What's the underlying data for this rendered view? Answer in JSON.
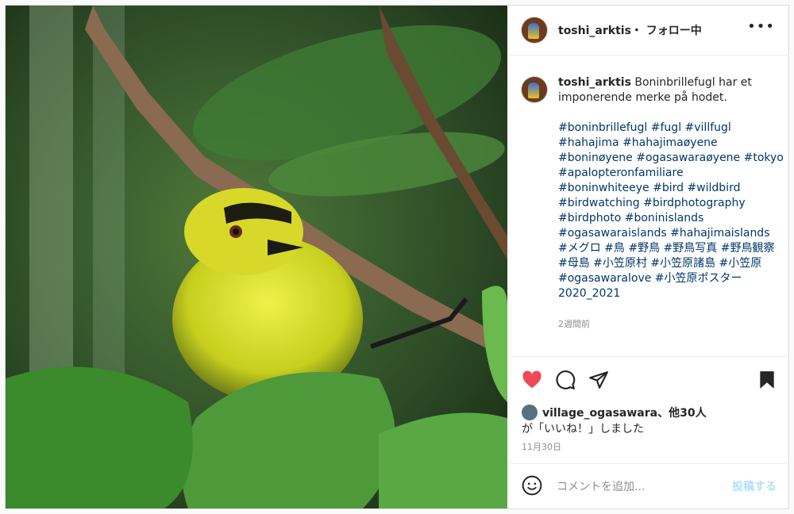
{
  "post": {
    "username": "toshi_arktis",
    "follow_status": "・ フォロー中",
    "more_label": "•••",
    "caption_text": "Boninbrillefugl har et imponerende merke på hodet.",
    "hashtag_lines": [
      "#boninbrillefugl #fugl #villfugl",
      "#hahajima #hahajimaøyene",
      "#boninøyene #ogasawaraøyene #tokyo",
      "#apalopteronfamiliare",
      "#boninwhiteeye #bird #wildbird",
      "#birdwatching #birdphotography",
      "#birdphoto #boninislands",
      "#ogasawaraislands #hahajimaislands",
      "#メグロ #鳥 #野鳥 #野鳥写真 #野鳥観察",
      "#母島 #小笠原村 #小笠原諸島 #小笠原",
      "#ogasawaralove #小笠原ポスター",
      "2020_2021"
    ],
    "caption_age": "2週間前",
    "liked_by_user": "village_ogasawara",
    "liked_by_others": "、他30人",
    "liked_suffix": "が「いいね！」しました",
    "date": "11月30日",
    "comment_placeholder": "コメントを追加...",
    "post_button": "投稿する"
  },
  "icons": {
    "like": "heart-filled-icon",
    "comment": "comment-bubble-icon",
    "share": "paper-plane-icon",
    "save": "bookmark-filled-icon",
    "emoji": "smiley-icon",
    "more": "ellipsis-icon"
  },
  "colors": {
    "like_red": "#ed4956",
    "link_blue": "#00376b",
    "post_disabled": "#b2dffc"
  }
}
